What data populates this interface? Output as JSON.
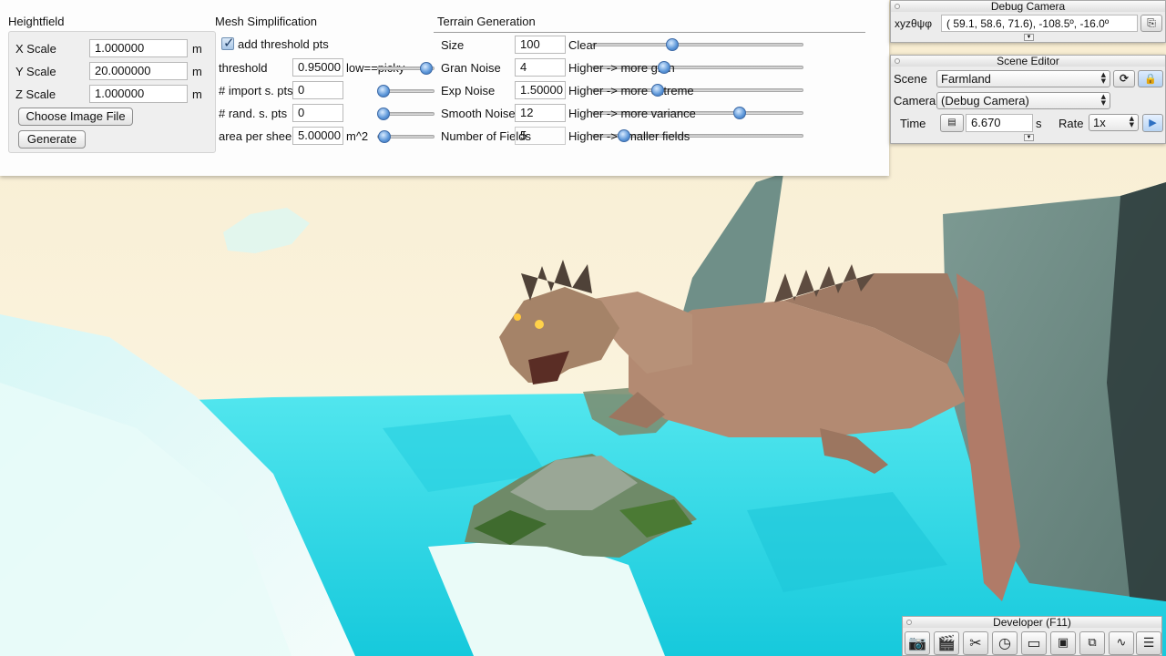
{
  "heightfield": {
    "title": "Heightfield",
    "x_scale": {
      "label": "X Scale",
      "value": "1.000000",
      "unit": "m"
    },
    "y_scale": {
      "label": "Y Scale",
      "value": "20.000000",
      "unit": "m"
    },
    "z_scale": {
      "label": "Z Scale",
      "value": "1.000000",
      "unit": "m"
    },
    "choose_label": "Choose Image File",
    "generate_label": "Generate"
  },
  "mesh": {
    "title": "Mesh Simplification",
    "add_threshold_label": "add threshold pts",
    "add_threshold_checked": true,
    "threshold": {
      "label": "threshold",
      "value": "0.95000",
      "hint": "low==picky",
      "level": 0.95
    },
    "import_pts": {
      "label": "# import s. pts",
      "value": "0",
      "level": 0.0
    },
    "rand_pts": {
      "label": "# rand. s. pts",
      "value": "0",
      "level": 0.0
    },
    "area": {
      "label": "area per sheep",
      "value": "5.00000",
      "unit": "m^2",
      "level": 0.02
    }
  },
  "terrain": {
    "title": "Terrain Generation",
    "size": {
      "label": "Size",
      "value": "100",
      "hint": "Clear",
      "level": 0.37
    },
    "gran": {
      "label": "Gran Noise",
      "value": "4",
      "hint": "Higher -> more gran",
      "level": 0.33
    },
    "exp": {
      "label": "Exp Noise",
      "value": "1.50000",
      "hint": "Higher -> more extreme",
      "level": 0.3
    },
    "smooth": {
      "label": "Smooth Noise",
      "value": "12",
      "hint": "Higher -> more variance",
      "level": 0.71
    },
    "fields": {
      "label": "Number of Fields",
      "value": "5",
      "hint": "Higher -> smaller fields",
      "level": 0.13
    }
  },
  "debug_camera": {
    "title": "Debug Camera",
    "coord_label": "xyzθψφ",
    "coords": "( 59.1,  58.6,  71.6), -108.5º, -16.0º"
  },
  "scene_editor": {
    "title": "Scene Editor",
    "scene_label": "Scene",
    "scene_value": "Farmland",
    "camera_label": "Camera",
    "camera_value": "(Debug Camera)",
    "time_label": "Time",
    "time_value": "6.670",
    "time_unit": "s",
    "rate_label": "Rate",
    "rate_value": "1x"
  },
  "developer": {
    "title": "Developer (F11)",
    "tools": [
      "camera-icon",
      "clapperboard-icon",
      "tools-icon",
      "clock-icon",
      "note-icon",
      "terminal-icon",
      "window-icon",
      "waveform-icon",
      "document-icon"
    ]
  },
  "colors": {
    "sky": "#fbf3dc",
    "water": "#2fd9e6",
    "ice": "#eafaf8",
    "dragon_skin": "#b58b73",
    "dragon_wing": "#6f8d86",
    "slider_knob": "#5a95d8"
  }
}
